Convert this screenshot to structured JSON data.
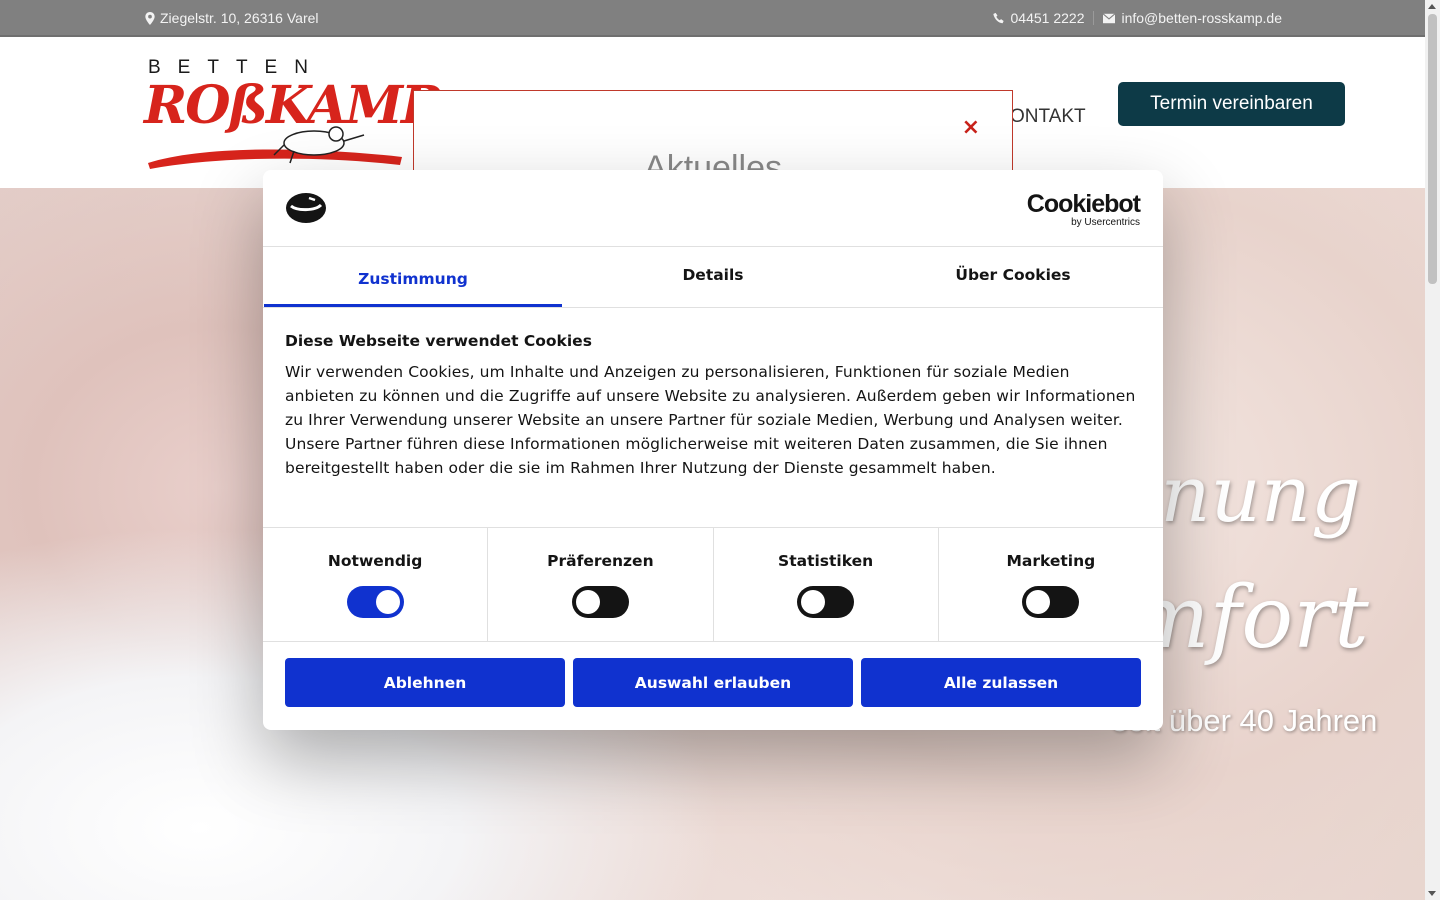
{
  "topbar": {
    "address": "Ziegelstr. 10, 26316 Varel",
    "phone": "04451 2222",
    "email": "info@betten-rosskamp.de"
  },
  "header": {
    "logo_top": "BETTEN",
    "logo_main": "ROßKAMP",
    "nav_kontakt": "ONTAKT",
    "cta_button": "Termin vereinbaren"
  },
  "popup": {
    "title": "Aktuelles",
    "close": "×"
  },
  "hero": {
    "line1": "nnung",
    "line2": "mfort",
    "subtitle": "seit über 40 Jahren"
  },
  "cookie": {
    "brand": "Cookiebot",
    "brand_sub": "by Usercentrics",
    "tabs": [
      {
        "label": "Zustimmung",
        "active": true
      },
      {
        "label": "Details",
        "active": false
      },
      {
        "label": "Über Cookies",
        "active": false
      }
    ],
    "heading": "Diese Webseite verwendet Cookies",
    "text": "Wir verwenden Cookies, um Inhalte und Anzeigen zu personalisieren, Funktionen für soziale Medien anbieten zu können und die Zugriffe auf unsere Website zu analysieren. Außerdem geben wir Informationen zu Ihrer Verwendung unserer Website an unsere Partner für soziale Medien, Werbung und Analysen weiter. Unsere Partner führen diese Informationen möglicherweise mit weiteren Daten zusammen, die Sie ihnen bereitgestellt haben oder die sie im Rahmen Ihrer Nutzung der Dienste gesammelt haben.",
    "toggles": [
      {
        "label": "Notwendig",
        "on": true
      },
      {
        "label": "Präferenzen",
        "on": false
      },
      {
        "label": "Statistiken",
        "on": false
      },
      {
        "label": "Marketing",
        "on": false
      }
    ],
    "buttons": {
      "deny": "Ablehnen",
      "allow_selection": "Auswahl erlauben",
      "allow_all": "Alle zulassen"
    }
  },
  "colors": {
    "accent": "#1032cf",
    "brand_red": "#d7241c",
    "cta_dark": "#0d3a47"
  }
}
